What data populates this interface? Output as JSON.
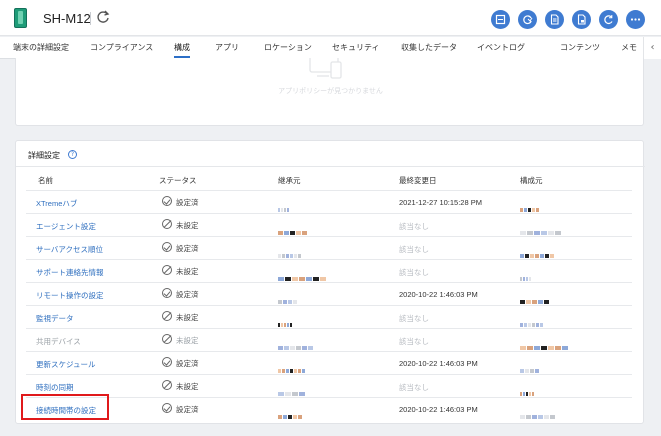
{
  "header": {
    "device_name": "SH-M12",
    "action_buttons": [
      "export-icon",
      "sync-icon",
      "document-icon",
      "lock-document-icon",
      "reload-icon",
      "more-icon"
    ]
  },
  "tabs": [
    {
      "label": "端末の詳細設定",
      "active": false
    },
    {
      "label": "コンプライアンス",
      "active": false
    },
    {
      "label": "構成",
      "active": true
    },
    {
      "label": "アプリ",
      "active": false
    },
    {
      "label": "ロケーション",
      "active": false
    },
    {
      "label": "セキュリティ",
      "active": false
    },
    {
      "label": "収集したデータ",
      "active": false
    },
    {
      "label": "イベントログ",
      "active": false
    },
    {
      "label": "コンテンツ",
      "active": false
    },
    {
      "label": "メモ",
      "active": false
    }
  ],
  "empty_state": {
    "text": "アプリポリシーが見つかりません"
  },
  "details": {
    "title": "詳細設定",
    "columns": {
      "name": "名前",
      "status": "ステータス",
      "inherited": "継承元",
      "modified": "最終変更日",
      "config": "構成元"
    },
    "rows": [
      {
        "name": "XTremeハブ",
        "status": "設定済",
        "state": "ok",
        "modified": "2021-12-27 10:15:28 PM",
        "disabled": false
      },
      {
        "name": "エージェント設定",
        "status": "未設定",
        "state": "no",
        "modified": "該当なし",
        "disabled": false
      },
      {
        "name": "サーバアクセス順位",
        "status": "設定済",
        "state": "ok",
        "modified": "該当なし",
        "disabled": false
      },
      {
        "name": "サポート連絡先情報",
        "status": "未設定",
        "state": "no",
        "modified": "該当なし",
        "disabled": false
      },
      {
        "name": "リモート操作の設定",
        "status": "設定済",
        "state": "ok",
        "modified": "2020-10-22 1:46:03 PM",
        "disabled": false
      },
      {
        "name": "監視データ",
        "status": "未設定",
        "state": "no",
        "modified": "該当なし",
        "disabled": false
      },
      {
        "name": "共用デバイス",
        "status": "未設定",
        "state": "no",
        "modified": "該当なし",
        "disabled": true
      },
      {
        "name": "更新スケジュール",
        "status": "設定済",
        "state": "ok",
        "modified": "2020-10-22 1:46:03 PM",
        "disabled": false
      },
      {
        "name": "時刻の同期",
        "status": "未設定",
        "state": "no",
        "modified": "該当なし",
        "disabled": false
      },
      {
        "name": "接続時間帯の設定",
        "status": "設定済",
        "state": "ok",
        "modified": "2020-10-22 1:46:03 PM",
        "disabled": false
      }
    ]
  },
  "colors": {
    "accent": "#3f7bd1",
    "link": "#2f6fbf",
    "highlight": "#e0191b"
  }
}
